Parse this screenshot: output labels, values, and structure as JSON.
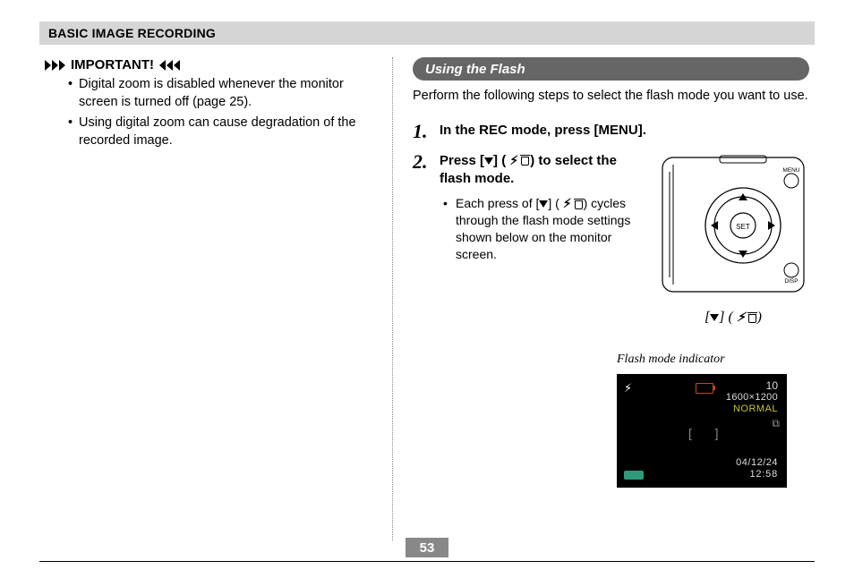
{
  "header": {
    "title": "BASIC IMAGE RECORDING"
  },
  "left": {
    "important_label": "IMPORTANT!",
    "bullets": [
      "Digital zoom is disabled whenever the monitor screen is turned off (page 25).",
      "Using digital zoom can cause degradation of the recorded image."
    ]
  },
  "right": {
    "section_title": "Using the Flash",
    "intro": "Perform the following steps to select the flash mode you want to use.",
    "step1_num": "1.",
    "step1": "In the REC mode, press [MENU].",
    "step2_num": "2.",
    "step2_a": "Press [",
    "step2_b": "] (",
    "step2_c": ") to select the flash mode.",
    "sub_a": "Each press of [",
    "sub_b": "] (",
    "sub_c": ") cycles through the flash mode settings shown below on the monitor screen.",
    "cam_caption_a": "[",
    "cam_caption_b": "] (",
    "cam_caption_c": ")",
    "flash_indicator_label": "Flash mode indicator"
  },
  "cam_labels": {
    "menu": "MENU",
    "set": "SET",
    "disp": "DISP"
  },
  "monitor": {
    "shots": "10",
    "resolution": "1600×1200",
    "quality": "NORMAL",
    "date": "04/12/24",
    "time": "12:58"
  },
  "page_number": "53"
}
